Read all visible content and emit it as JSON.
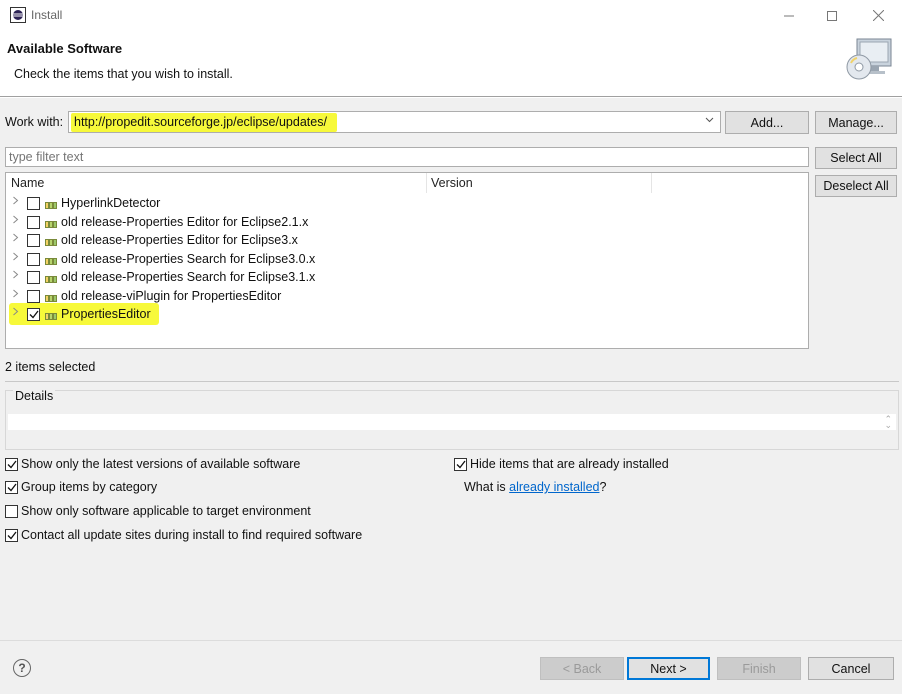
{
  "window": {
    "title": "Install",
    "controls": [
      "minimize",
      "maximize",
      "close"
    ]
  },
  "header": {
    "title": "Available Software",
    "subtitle": "Check the items that you wish to install."
  },
  "work_with": {
    "label": "Work with:",
    "value": "http://propedit.sourceforge.jp/eclipse/updates/",
    "add_label": "Add...",
    "manage_label": "Manage..."
  },
  "filter": {
    "placeholder": "type filter text"
  },
  "side_buttons": {
    "select_all": "Select All",
    "deselect_all": "Deselect All"
  },
  "tree": {
    "columns": [
      "Name",
      "Version"
    ],
    "items": [
      {
        "label": "HyperlinkDetector",
        "checked": false
      },
      {
        "label": "old release-Properties Editor for Eclipse2.1.x",
        "checked": false
      },
      {
        "label": "old release-Properties Editor for Eclipse3.x",
        "checked": false
      },
      {
        "label": "old release-Properties Search for Eclipse3.0.x",
        "checked": false
      },
      {
        "label": "old release-Properties Search for Eclipse3.1.x",
        "checked": false
      },
      {
        "label": "old release-viPlugin for PropertiesEditor",
        "checked": false
      },
      {
        "label": "PropertiesEditor",
        "checked": true
      }
    ]
  },
  "status": "2 items selected",
  "details": {
    "legend": "Details"
  },
  "options": {
    "latest_versions": {
      "label": "Show only the latest versions of available software",
      "checked": true
    },
    "group_by_category": {
      "label": "Group items by category",
      "checked": true
    },
    "target_env": {
      "label": "Show only software applicable to target environment",
      "checked": false
    },
    "contact_sites": {
      "label": "Contact all update sites during install to find required software",
      "checked": true
    },
    "hide_installed": {
      "label": "Hide items that are already installed",
      "checked": true
    },
    "what_is_prefix": "What is ",
    "what_is_link": "already installed",
    "what_is_suffix": "?"
  },
  "footer": {
    "help": "?",
    "back": "< Back",
    "next": "Next >",
    "finish": "Finish",
    "cancel": "Cancel"
  },
  "colors": {
    "highlight": "#f7f93a",
    "link": "#0066cc",
    "panel_bg": "#f0f0f0",
    "primary_border": "#0078d7"
  }
}
